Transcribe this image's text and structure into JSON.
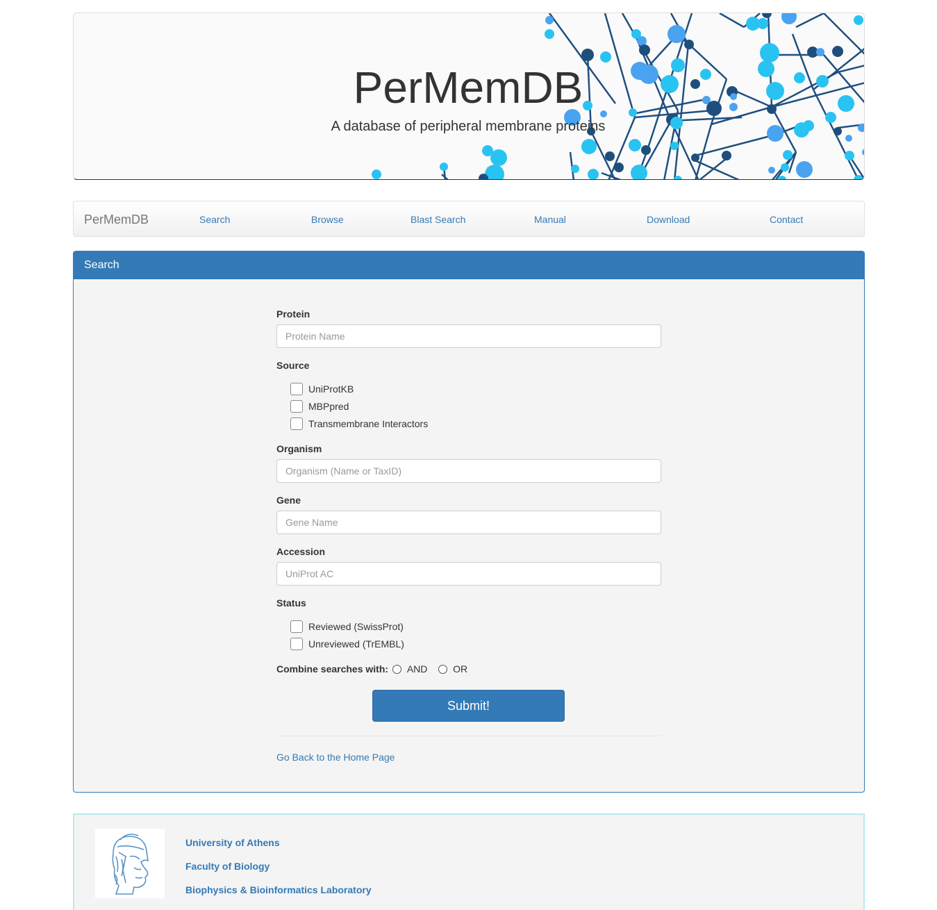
{
  "banner": {
    "title": "PerMemDB",
    "subtitle": "A database of peripheral membrane proteins"
  },
  "navbar": {
    "brand": "PerMemDB",
    "items": [
      "Search",
      "Browse",
      "Blast Search",
      "Manual",
      "Download",
      "Contact"
    ]
  },
  "panel": {
    "heading": "Search"
  },
  "form": {
    "protein": {
      "label": "Protein",
      "placeholder": "Protein Name",
      "value": ""
    },
    "source": {
      "label": "Source",
      "options": [
        "UniProtKB",
        "MBPpred",
        "Transmembrane Interactors"
      ]
    },
    "organism": {
      "label": "Organism",
      "placeholder": "Organism (Name or TaxID)",
      "value": ""
    },
    "gene": {
      "label": "Gene",
      "placeholder": "Gene Name",
      "value": ""
    },
    "accession": {
      "label": "Accession",
      "placeholder": "UniProt AC",
      "value": ""
    },
    "status": {
      "label": "Status",
      "options": [
        "Reviewed (SwissProt)",
        "Unreviewed (TrEMBL)"
      ]
    },
    "combine": {
      "label": "Combine searches with:",
      "options": [
        "AND",
        "OR"
      ]
    },
    "submit_label": "Submit!",
    "back_link": "Go Back to the Home Page"
  },
  "footer": {
    "links": [
      "University of Athens",
      "Faculty of Biology",
      "Biophysics & Bioinformatics Laboratory"
    ]
  },
  "colors": {
    "primary": "#337ab7",
    "panel_bg": "#f4f4f4",
    "footer_border": "#bce8f1",
    "network_light": "#29c3f2",
    "network_mid": "#4aa3f0",
    "network_dark": "#1e4f7c"
  }
}
